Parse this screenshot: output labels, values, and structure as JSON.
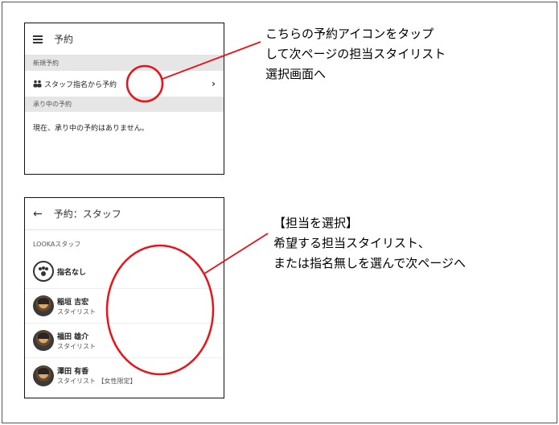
{
  "screen1": {
    "title": "予約",
    "section_new": "新規予約",
    "staff_link": "スタッフ指名から予約",
    "chevron": "›",
    "section_accepted": "承り中の予約",
    "empty_message": "現在、承り中の予約はありません。"
  },
  "screen2": {
    "title": "予約：スタッフ",
    "back": "←",
    "group_label": "LOOKAスタッフ",
    "staff": [
      {
        "name": "指名なし",
        "role": ""
      },
      {
        "name": "稲垣 吉宏",
        "role": "スタイリスト"
      },
      {
        "name": "福田 雄介",
        "role": "スタイリスト"
      },
      {
        "name": "澤田 有香",
        "role": "スタイリスト 【女性限定】"
      }
    ]
  },
  "annotations": {
    "note1": [
      "こちらの予約アイコンをタップ",
      "して次ページの担当スタイリスト",
      "選択画面へ"
    ],
    "note2": [
      "【担当を選択】",
      "希望する担当スタイリスト、",
      "または指名無しを選んで次ページへ"
    ]
  },
  "colors": {
    "annotation_red": "#e8141c",
    "section_gray": "#e6e6e6"
  }
}
